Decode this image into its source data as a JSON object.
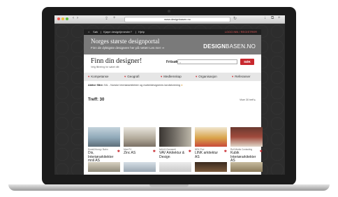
{
  "browser": {
    "url": "www.designbasen.no"
  },
  "site": {
    "topnav": {
      "home_label": "Søk",
      "crumb_separator": "|",
      "register_link": "Kjøpe designtjenester?",
      "help_link": "Hjelp",
      "login_link": "LOGG INN / REGISTRER"
    },
    "banner": {
      "title": "Norges største designportal",
      "subtitle": "Finn de dyktigste designere her på nettet! Les mer ⇒",
      "logo_main": "DESIGN",
      "logo_suffix": "BASEN.NO"
    },
    "finn": {
      "heading": "Finn din designer!",
      "subtext": "Velg filtrering for søket ditt",
      "search_label": "Fritsøk:",
      "search_placeholder": "",
      "search_button": "SØK"
    },
    "filters": [
      {
        "label": "Kompetanse"
      },
      {
        "label": "Geografi"
      },
      {
        "label": "Medlemskap"
      },
      {
        "label": "Organisasjon"
      },
      {
        "label": "Referanser"
      }
    ],
    "active_filters": {
      "label": "Aktive filtre:",
      "value": "NIL - Norske Interiørarkitekter og møbeldesigneres landsforening"
    },
    "results": {
      "count_label": "Treff: 30",
      "viser_label": "Viser 30 treff ▸"
    },
    "cards": [
      {
        "category": "Ernst&Young / Bahn",
        "name": "Dis, Interiørarkitekter mnil AS",
        "color": "#8fa8b8"
      },
      {
        "category": "MoreTV",
        "name": "Zinc AS",
        "color": "#b0a898"
      },
      {
        "category": "NAV/A Overseeti",
        "name": "VAV Arkitektur & Design",
        "color": "#6f6a63"
      },
      {
        "category": "NRK Proi",
        "name": "LINK arkitektur AS",
        "color": "#d9a44a"
      },
      {
        "category": "Roll Media Contacting",
        "name": "Kubik Interiørarkitekter AS",
        "color": "#a04a3c"
      }
    ],
    "row2_colors": [
      "#8f8a7a",
      "#9aa7b2",
      "#c9c9c9",
      "#7a5a3c",
      "#8a7a5a"
    ]
  }
}
